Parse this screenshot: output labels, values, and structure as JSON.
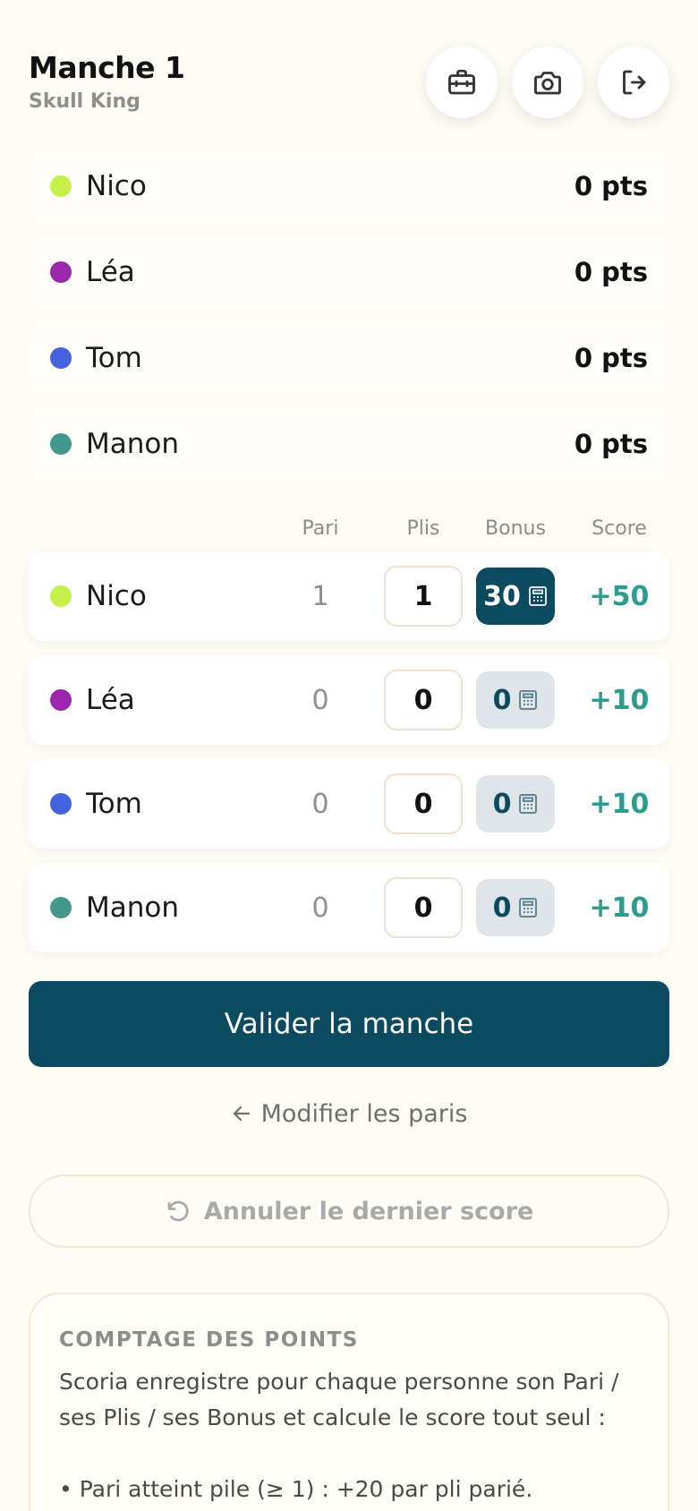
{
  "header": {
    "title": "Manche 1",
    "subtitle": "Skull King",
    "buttons": [
      {
        "icon": "toolbox-icon"
      },
      {
        "icon": "camera-icon"
      },
      {
        "icon": "logout-icon"
      }
    ]
  },
  "ranking": [
    {
      "name": "Nico",
      "points": "0 pts",
      "color": "#c5f04a"
    },
    {
      "name": "Léa",
      "points": "0 pts",
      "color": "#9b27af"
    },
    {
      "name": "Tom",
      "points": "0 pts",
      "color": "#4661de"
    },
    {
      "name": "Manon",
      "points": "0 pts",
      "color": "#43988e"
    }
  ],
  "table": {
    "columns": {
      "bid": "Pari",
      "tricks": "Plis",
      "bonus": "Bonus",
      "score": "Score"
    },
    "rows": [
      {
        "name": "Nico",
        "color": "#c5f04a",
        "bid": "1",
        "tricks": "1",
        "bonus": "30",
        "bonus_active": true,
        "score": "+50"
      },
      {
        "name": "Léa",
        "color": "#9b27af",
        "bid": "0",
        "tricks": "0",
        "bonus": "0",
        "bonus_active": false,
        "score": "+10"
      },
      {
        "name": "Tom",
        "color": "#4661de",
        "bid": "0",
        "tricks": "0",
        "bonus": "0",
        "bonus_active": false,
        "score": "+10"
      },
      {
        "name": "Manon",
        "color": "#43988e",
        "bid": "0",
        "tricks": "0",
        "bonus": "0",
        "bonus_active": false,
        "score": "+10"
      }
    ]
  },
  "actions": {
    "validate_label": "Valider la manche",
    "modify_label": "Modifier les paris",
    "undo_label": "Annuler le dernier score"
  },
  "info": {
    "title": "COMPTAGE DES POINTS",
    "text": "Scoria enregistre pour chaque personne son Pari / ses Plis / ses Bonus et calcule le score tout seul :",
    "bullet": "• Pari atteint pile (≥ 1) : +20 par pli parié."
  },
  "colors": {
    "primary": "#0b4a5f",
    "score_positive": "#2a9d8f",
    "background": "#fdfcf5"
  }
}
